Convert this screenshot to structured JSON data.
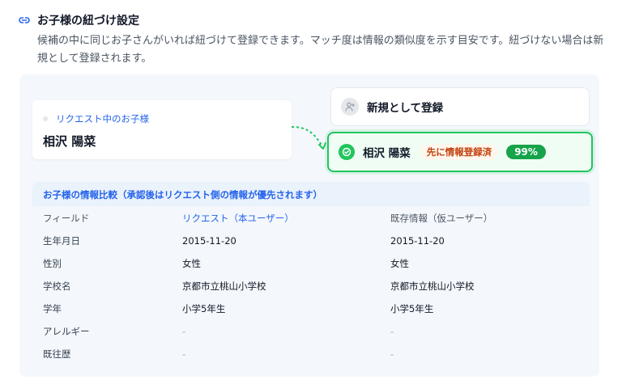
{
  "header": {
    "title": "お子様の紐づけ設定",
    "description": "候補の中に同じお子さんがいれば紐づけて登録できます。マッチ度は情報の類似度を示す目安です。紐づけない場合は新規として登録されます。"
  },
  "request_card": {
    "label": "リクエスト中のお子様",
    "name": "相沢 陽菜"
  },
  "options": {
    "new_label": "新規として登録",
    "match": {
      "name": "相沢 陽菜",
      "registered_badge": "先に情報登録済",
      "match_score": "99%"
    }
  },
  "comparison": {
    "title": "お子様の情報比較（承認後はリクエスト側の情報が優先されます）",
    "columns": [
      "フィールド",
      "リクエスト（本ユーザー）",
      "既存情報（仮ユーザー）"
    ],
    "rows": [
      [
        "生年月日",
        "2015-11-20",
        "2015-11-20"
      ],
      [
        "性別",
        "女性",
        "女性"
      ],
      [
        "学校名",
        "京都市立桃山小学校",
        "京都市立桃山小学校"
      ],
      [
        "学年",
        "小学5年生",
        "小学5年生"
      ],
      [
        "アレルギー",
        "-",
        "-"
      ],
      [
        "既往歴",
        "-",
        "-"
      ]
    ]
  },
  "colors": {
    "accent_blue": "#2563eb",
    "match_green": "#22c55e",
    "badge_orange": "#c2410c"
  },
  "icons": {
    "title": "link-icon",
    "new_option": "user-plus-icon",
    "match_option": "check-circle-icon"
  }
}
